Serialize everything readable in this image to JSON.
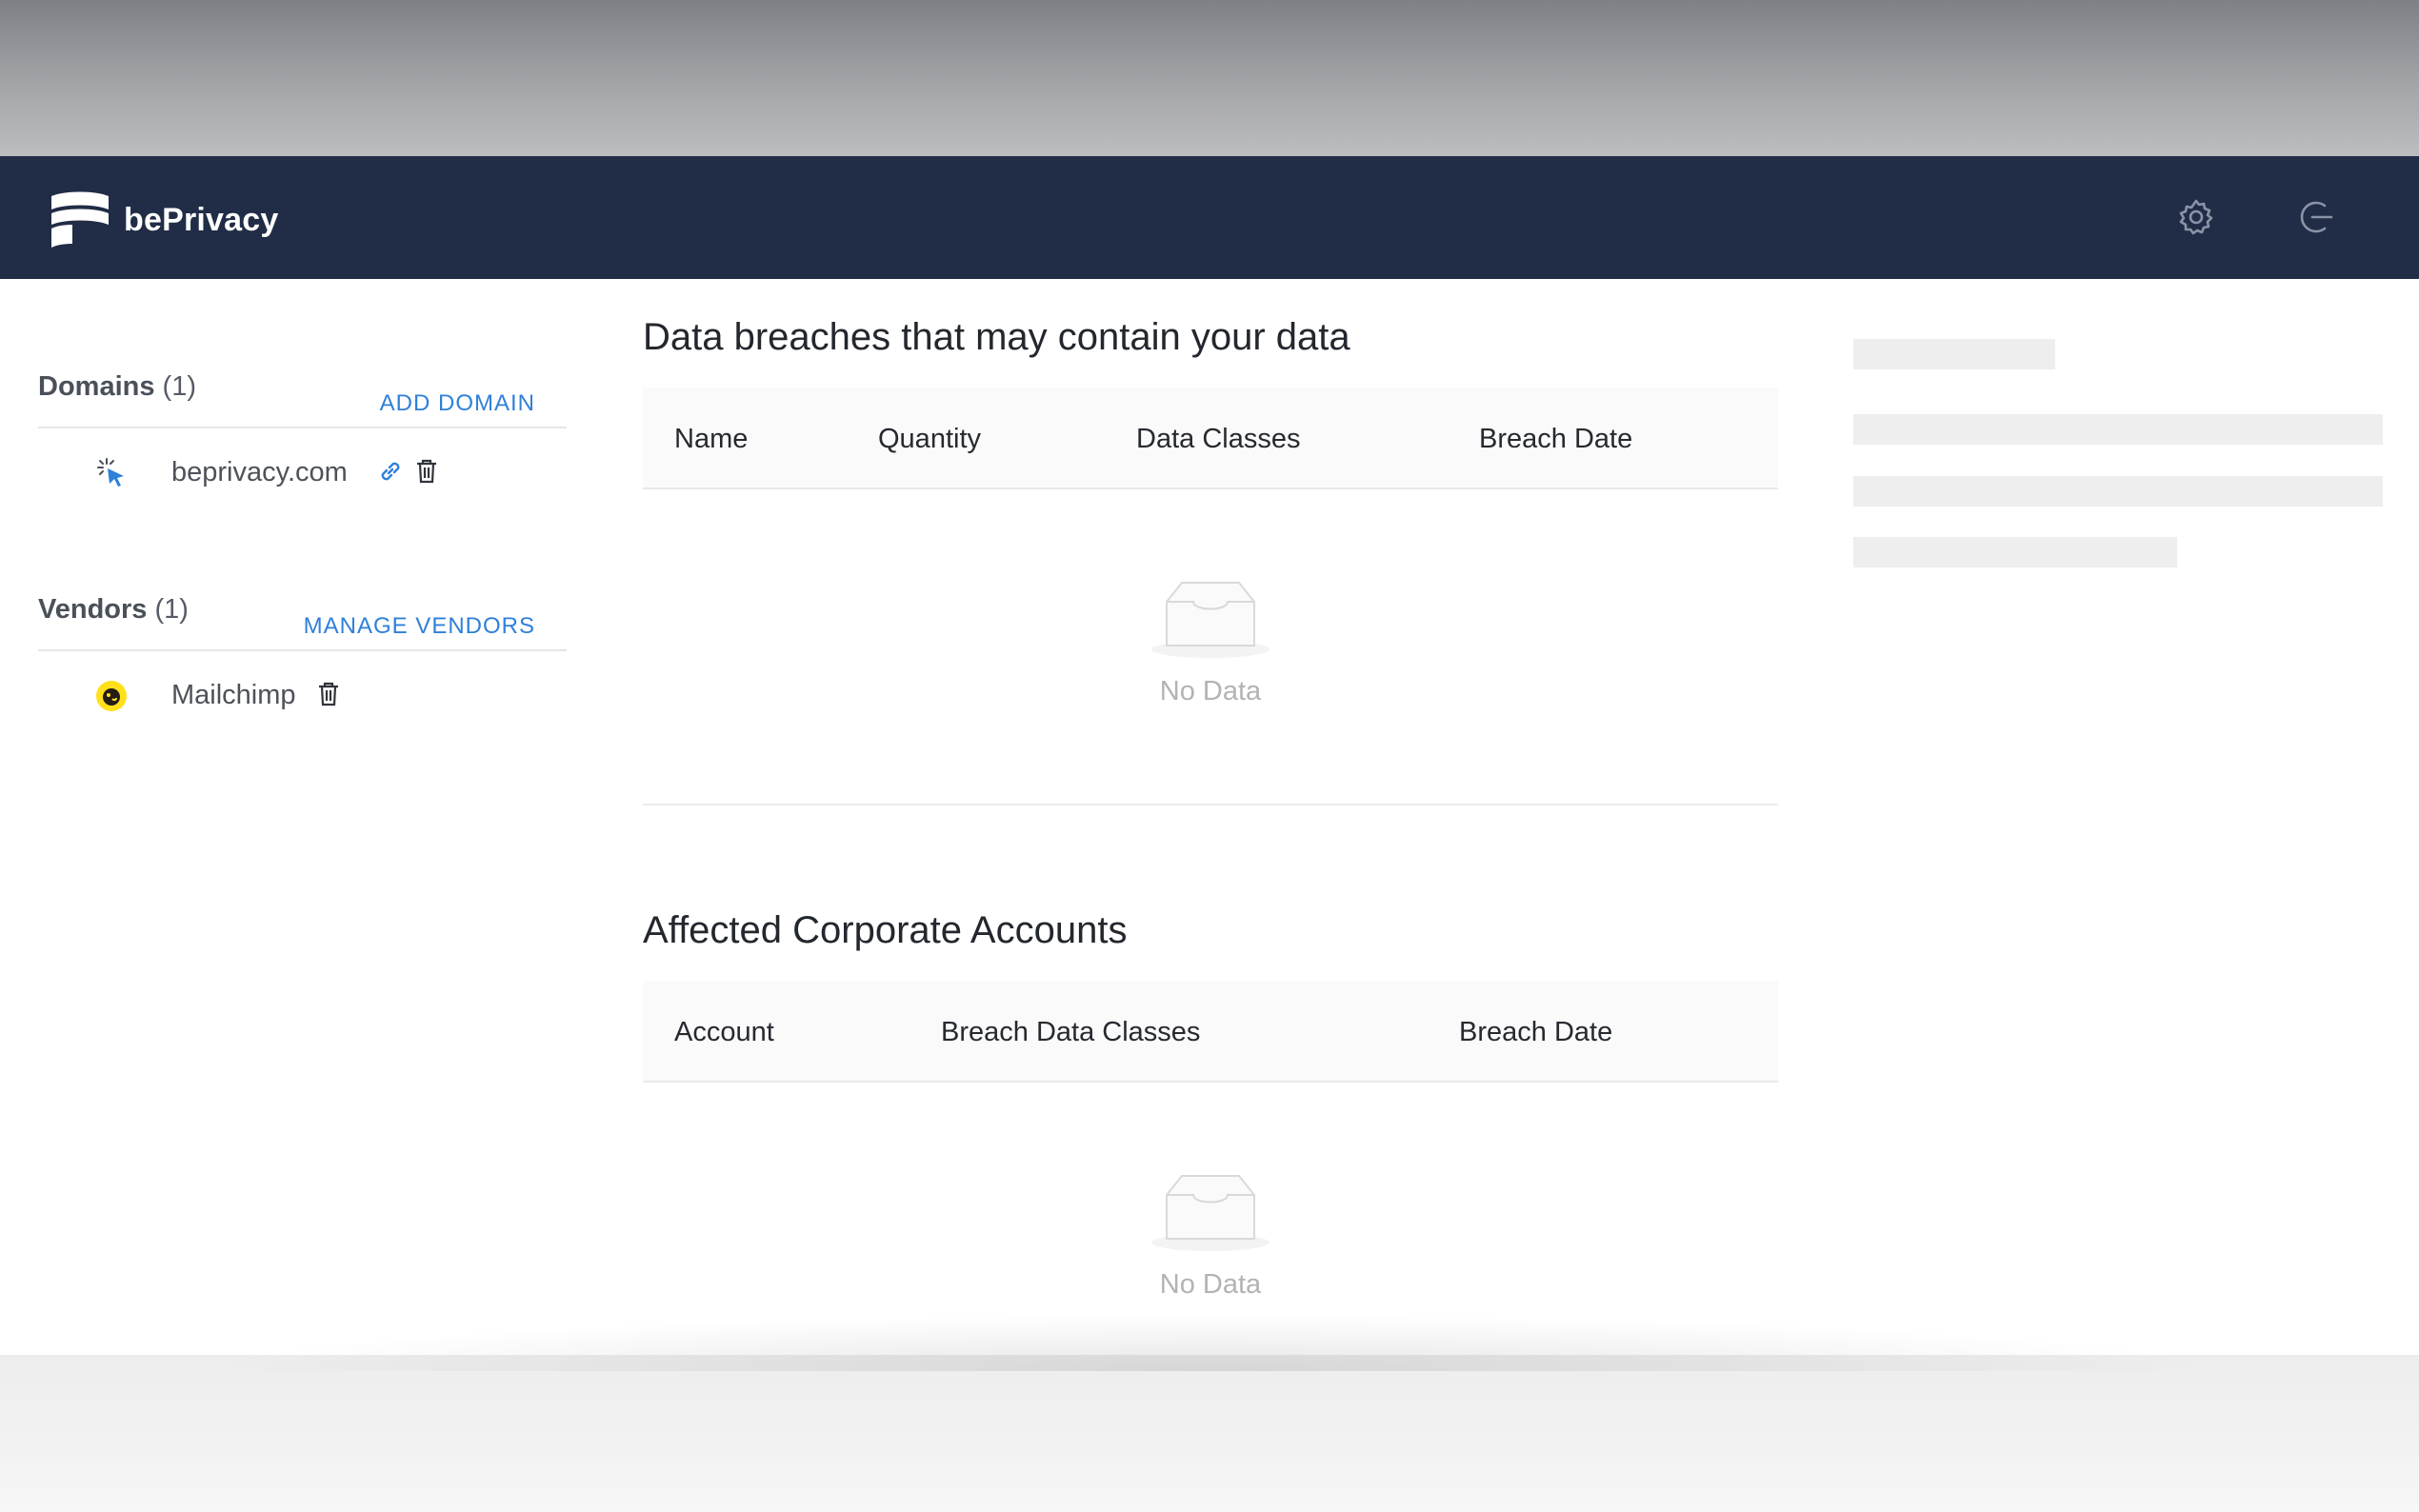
{
  "app": {
    "brand_name": "bePrivacy",
    "colors": {
      "topbar": "#212d46",
      "accent": "#2f80d9",
      "muted_text": "#b3b3b3"
    }
  },
  "header": {
    "icons": [
      "settings-icon",
      "logout-icon"
    ]
  },
  "sidebar": {
    "domains": {
      "title": "Domains",
      "count": "(1)",
      "action_label": "ADD DOMAIN",
      "items": [
        {
          "label": "beprivacy.com",
          "icon": "loading-cursor-icon",
          "actions": [
            "link-icon",
            "trash-icon"
          ]
        }
      ]
    },
    "vendors": {
      "title": "Vendors",
      "count": "(1)",
      "action_label": "MANAGE VENDORS",
      "items": [
        {
          "label": "Mailchimp",
          "icon": "mailchimp-logo-icon",
          "actions": [
            "trash-icon"
          ]
        }
      ]
    }
  },
  "main": {
    "breaches": {
      "title": "Data breaches that may contain your data",
      "columns": [
        "Name",
        "Quantity",
        "Data Classes",
        "Breach Date"
      ],
      "rows": [],
      "empty_text": "No Data"
    },
    "accounts": {
      "title": "Affected Corporate Accounts",
      "columns": [
        "Account",
        "Breach Data Classes",
        "Breach Date"
      ],
      "rows": [],
      "empty_text": "No Data"
    }
  }
}
